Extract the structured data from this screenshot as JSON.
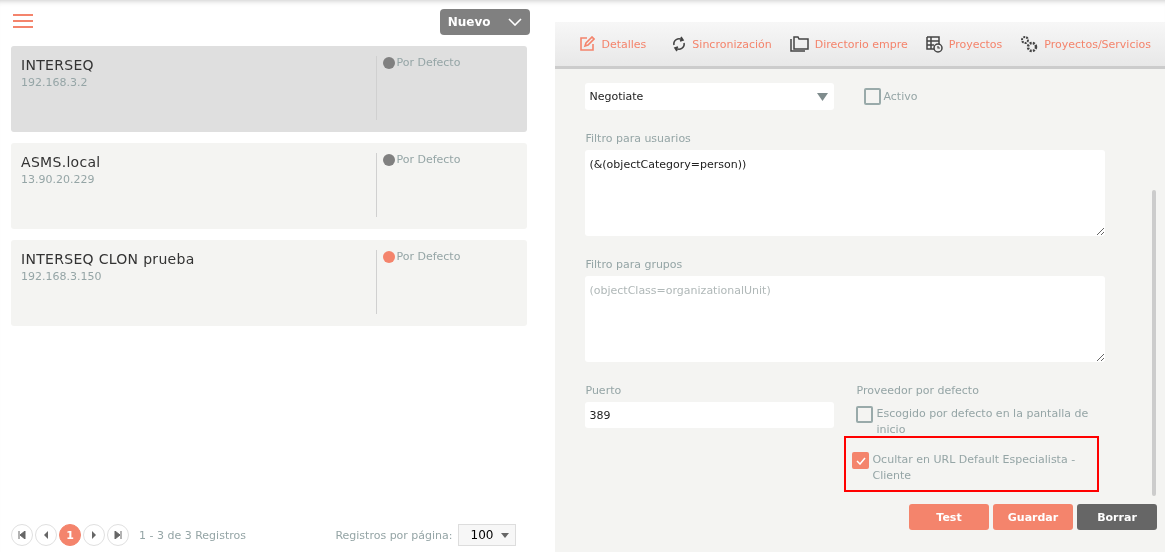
{
  "toolbar": {
    "new_button": "Nuevo"
  },
  "records": [
    {
      "name": "INTERSEQ",
      "address": "192.168.3.2",
      "badge": "Por Defecto",
      "color": "#808080",
      "selected": true
    },
    {
      "name": "ASMS.local",
      "address": "13.90.20.229",
      "badge": "Por Defecto",
      "color": "#808080",
      "selected": false
    },
    {
      "name": "INTERSEQ CLON prueba",
      "address": "192.168.3.150",
      "badge": "Por Defecto",
      "color": "#f4846c",
      "selected": false
    }
  ],
  "pagination": {
    "pages": [
      {
        "label": "1",
        "selected": true
      }
    ],
    "summary": "1 - 3 de 3 Registros",
    "per_page_label": "Registros por página:",
    "per_page": "100"
  },
  "tabs": [
    {
      "label": "Detalles",
      "kind": "edit",
      "selected": true
    },
    {
      "label": "Sincronización",
      "kind": "sync",
      "selected": false
    },
    {
      "label": "Directorio empre",
      "kind": "folders",
      "selected": false
    },
    {
      "label": "Proyectos",
      "kind": "table",
      "selected": false
    },
    {
      "label": "Proyectos/Servicios",
      "kind": "gears",
      "selected": false
    }
  ],
  "auth": {
    "value": "Negotiate",
    "active_label": "Activo",
    "active": false
  },
  "user_filter": {
    "label": "Filtro para usuarios",
    "value": "(&(objectCategory=person))"
  },
  "group_filter": {
    "label": "Filtro para grupos",
    "placeholder": "(objectClass=organizationalUnit)"
  },
  "port": {
    "label": "Puerto",
    "value": "389"
  },
  "provider": {
    "label": "Proveedor por defecto",
    "options": [
      {
        "label": "Escogido por defecto en la pantalla de inicio",
        "checked": false,
        "highlighted": false
      },
      {
        "label": "Ocultar en URL Default Especialista - Cliente",
        "checked": true,
        "highlighted": true
      }
    ]
  },
  "buttons": [
    {
      "label": "Test",
      "kind": "primary"
    },
    {
      "label": "Guardar",
      "kind": "primary"
    },
    {
      "label": "Borrar",
      "kind": "dark"
    }
  ]
}
